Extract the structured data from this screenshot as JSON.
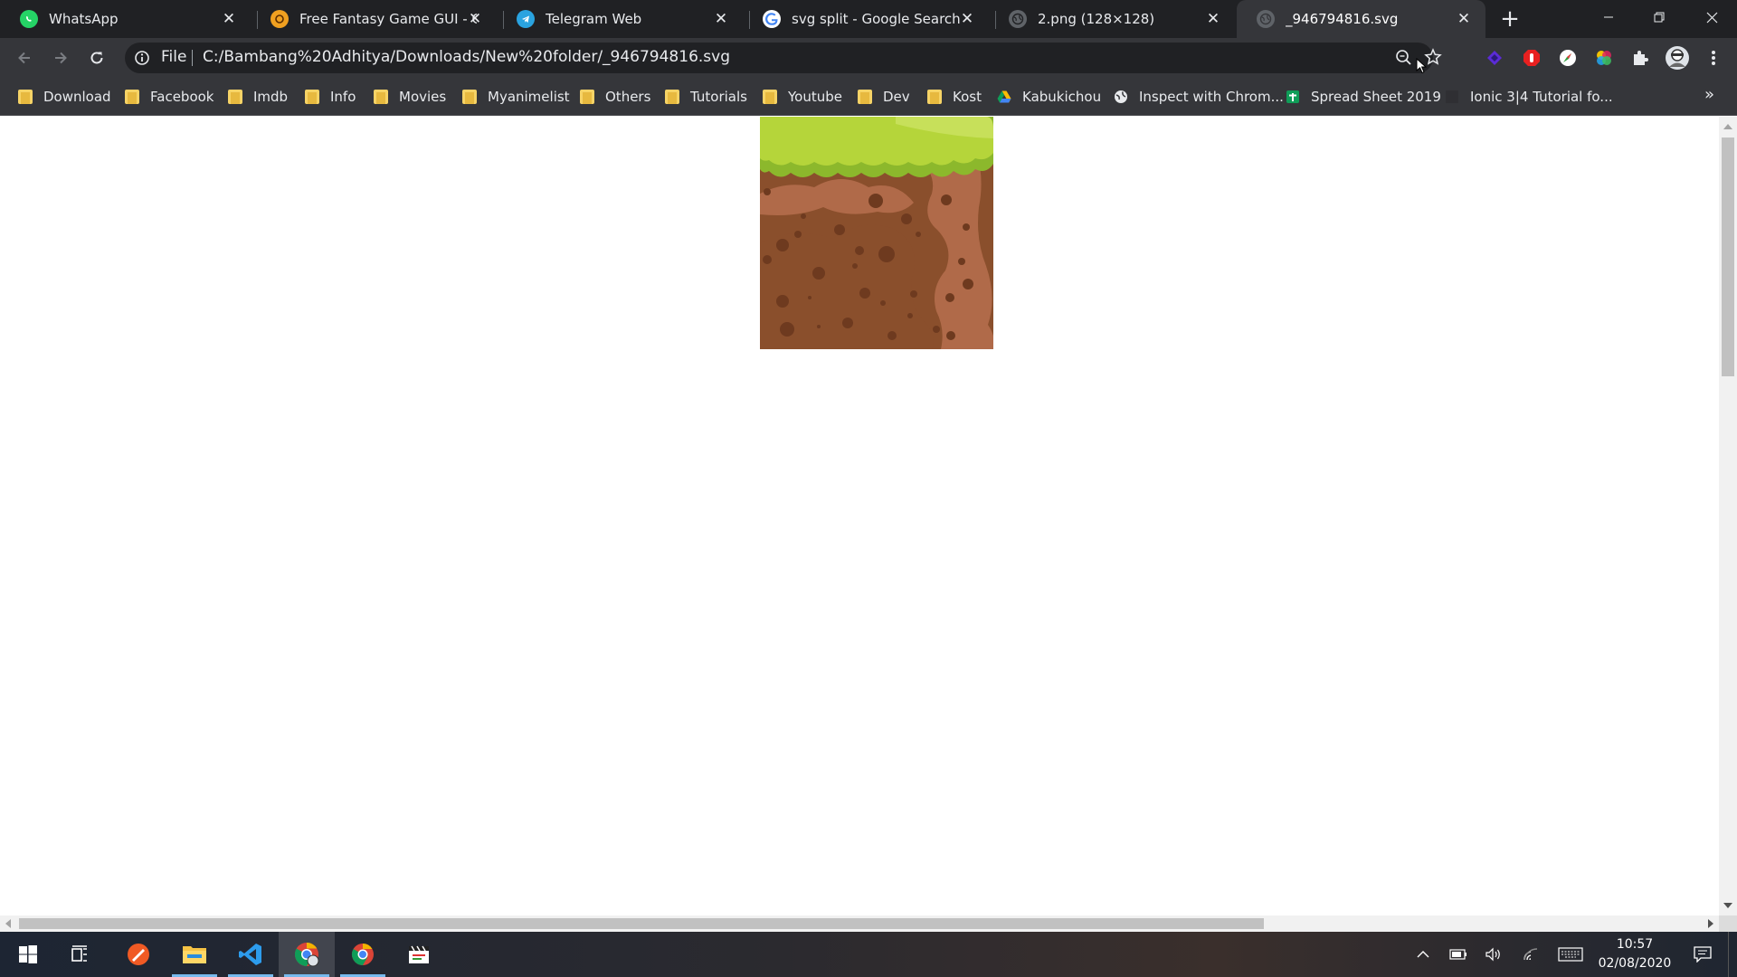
{
  "browser": {
    "tabs": [
      {
        "title": "WhatsApp",
        "icon": "whatsapp-icon",
        "active": false
      },
      {
        "title": "Free Fantasy Game GUI - Gam",
        "icon": "game-icon",
        "active": false
      },
      {
        "title": "Telegram Web",
        "icon": "telegram-icon",
        "active": false
      },
      {
        "title": "svg split - Google Search",
        "icon": "google-icon",
        "active": false
      },
      {
        "title": "2.png (128×128)",
        "icon": "globe-icon",
        "active": false
      },
      {
        "title": "_946794816.svg",
        "icon": "globe-icon",
        "active": true
      }
    ],
    "new_tab_label": "+",
    "close_glyph": "✕"
  },
  "toolbar": {
    "scheme_label": "File",
    "url": "C:/Bambang%20Adhitya/Downloads/New%20folder/_946794816.svg"
  },
  "bookmarks": [
    {
      "label": "Download",
      "icon": "folder-icon"
    },
    {
      "label": "Facebook",
      "icon": "folder-icon"
    },
    {
      "label": "Imdb",
      "icon": "folder-icon"
    },
    {
      "label": "Info",
      "icon": "folder-icon"
    },
    {
      "label": "Movies",
      "icon": "folder-icon"
    },
    {
      "label": "Myanimelist",
      "icon": "folder-icon"
    },
    {
      "label": "Others",
      "icon": "folder-icon"
    },
    {
      "label": "Tutorials",
      "icon": "folder-icon"
    },
    {
      "label": "Youtube",
      "icon": "folder-icon"
    },
    {
      "label": "Dev",
      "icon": "folder-icon"
    },
    {
      "label": "Kost",
      "icon": "folder-icon"
    },
    {
      "label": "Kabukichou",
      "icon": "google-drive-icon"
    },
    {
      "label": "Inspect with Chrom...",
      "icon": "globe-icon"
    },
    {
      "label": "Spread Sheet 2019",
      "icon": "sheets-icon"
    },
    {
      "label": "Ionic 3|4 Tutorial fo...",
      "icon": "page-icon"
    }
  ],
  "bookmarks_overflow": "»",
  "colors": {
    "grass_light": "#b5d53a",
    "grass_dark": "#8cb82c",
    "soil_light": "#b06a49",
    "soil_dark": "#8a4f2c",
    "soil_spots": "#6e3a1f"
  },
  "taskbar": {
    "apps": [
      "windows-start-icon",
      "task-view-icon",
      "sketch-app-icon",
      "file-explorer-icon",
      "vscode-icon",
      "chrome-profile-icon",
      "chrome-icon",
      "clapperboard-icon"
    ],
    "time": "10:57",
    "date": "02/08/2020"
  }
}
